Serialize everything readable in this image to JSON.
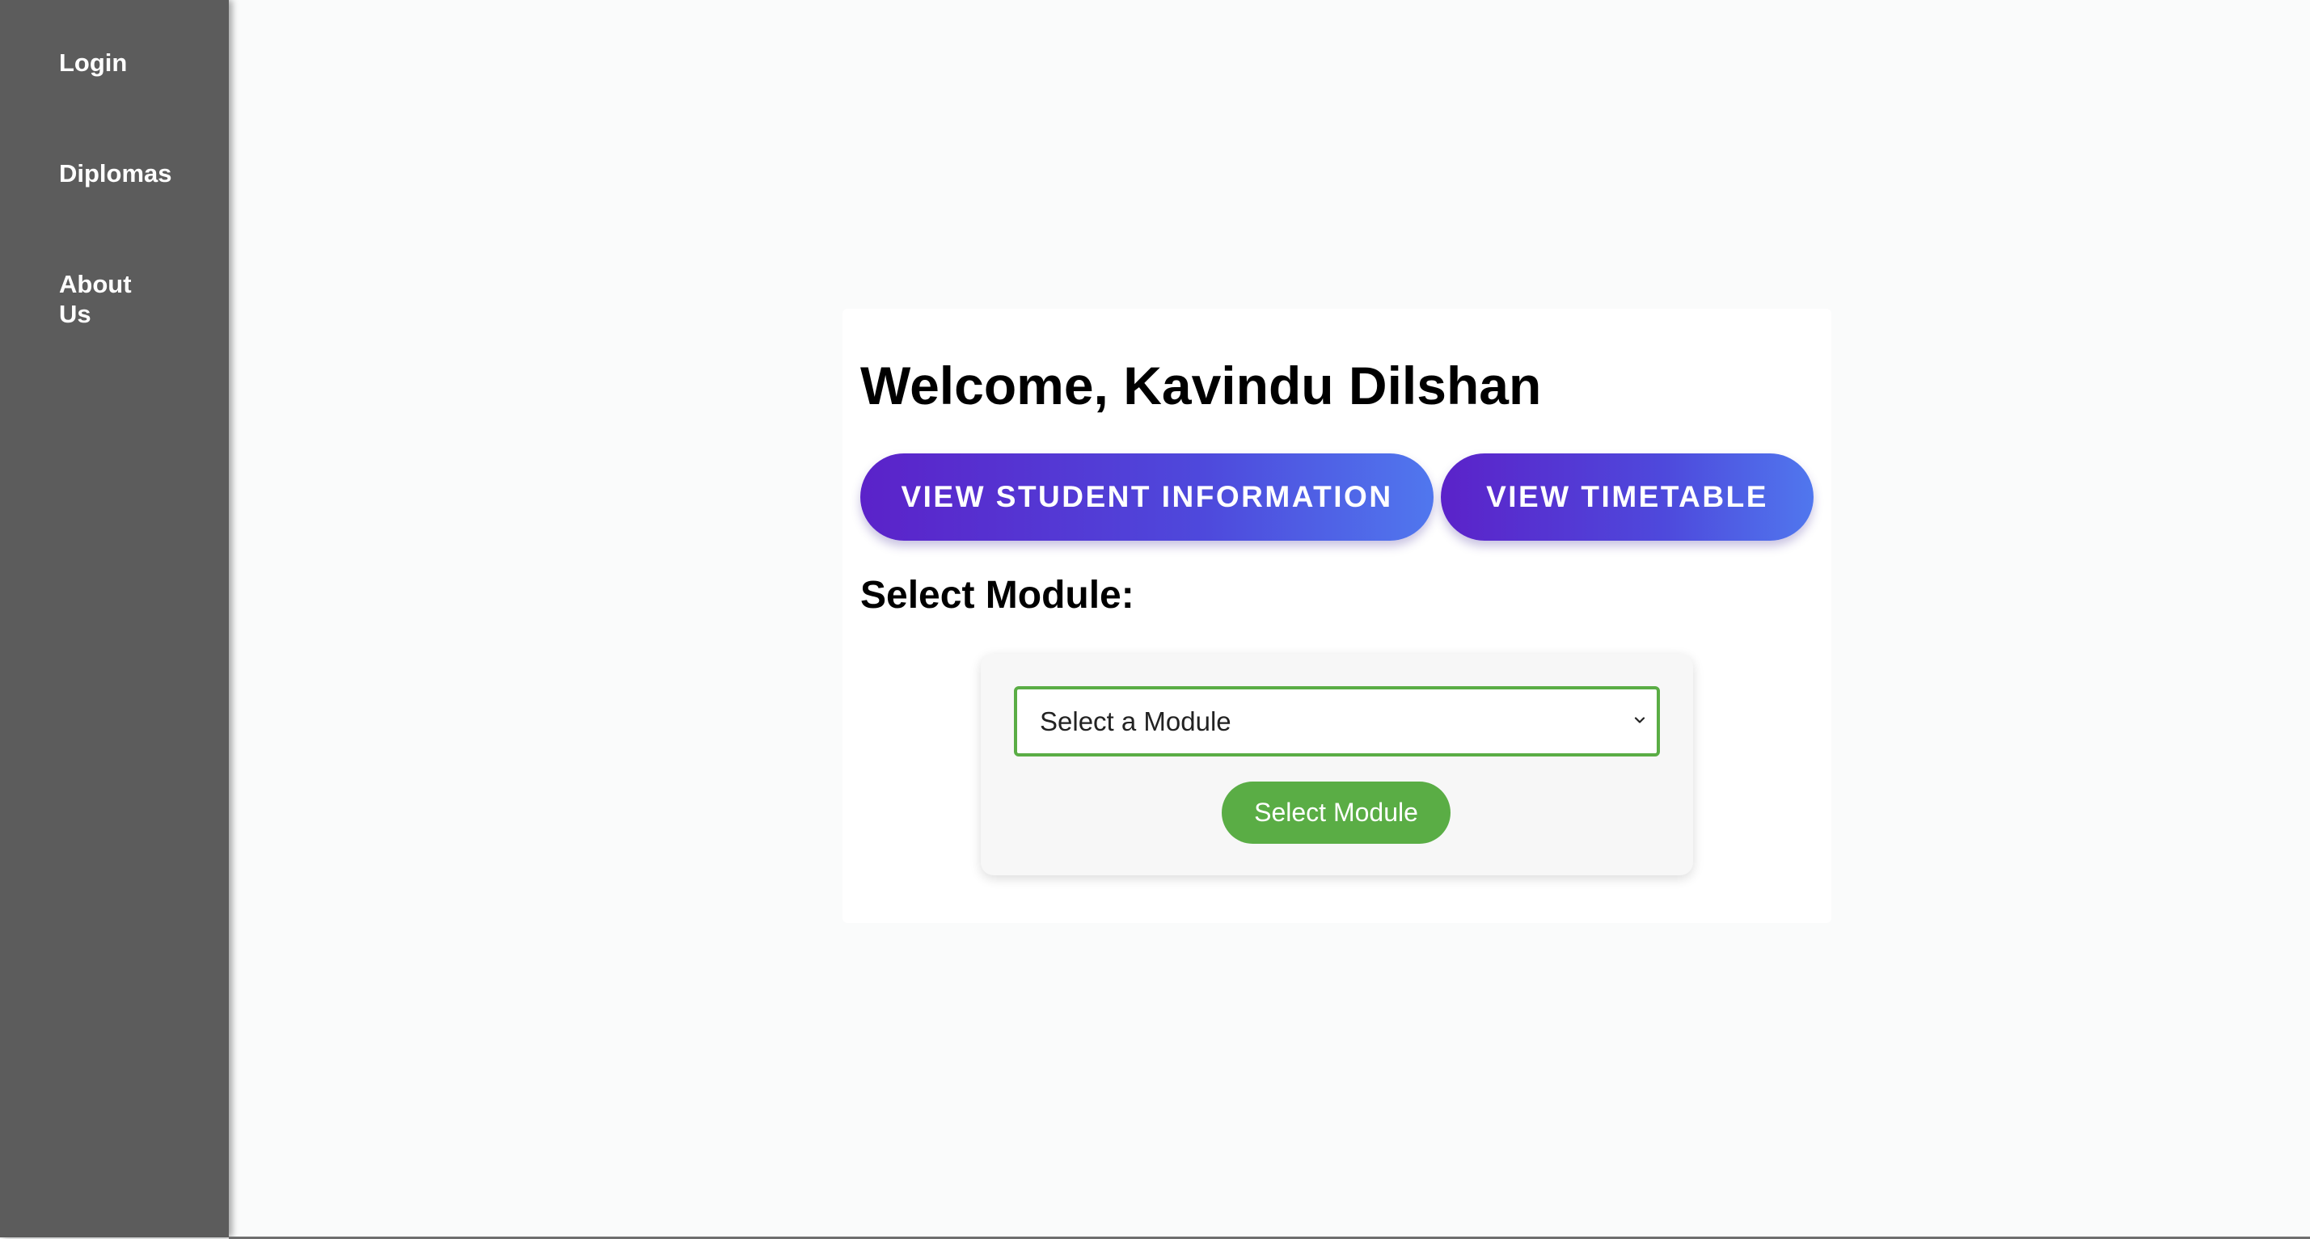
{
  "sidebar": {
    "items": [
      {
        "label": "Login"
      },
      {
        "label": "Diplomas"
      },
      {
        "label": "About Us"
      }
    ]
  },
  "main": {
    "welcome": "Welcome, Kavindu Dilshan",
    "buttons": {
      "student_info": "VIEW STUDENT INFORMATION",
      "timetable": "VIEW TIMETABLE"
    },
    "select_heading": "Select Module:",
    "module_select": {
      "selected": "Select a Module"
    },
    "select_button": "Select Module"
  },
  "colors": {
    "sidebar": "#5c5c5c",
    "gradient_start": "#5b22c9",
    "gradient_end": "#5077ee",
    "accent_green": "#5aad45"
  },
  "icons": {
    "dropdown": "chevron-down-icon"
  }
}
